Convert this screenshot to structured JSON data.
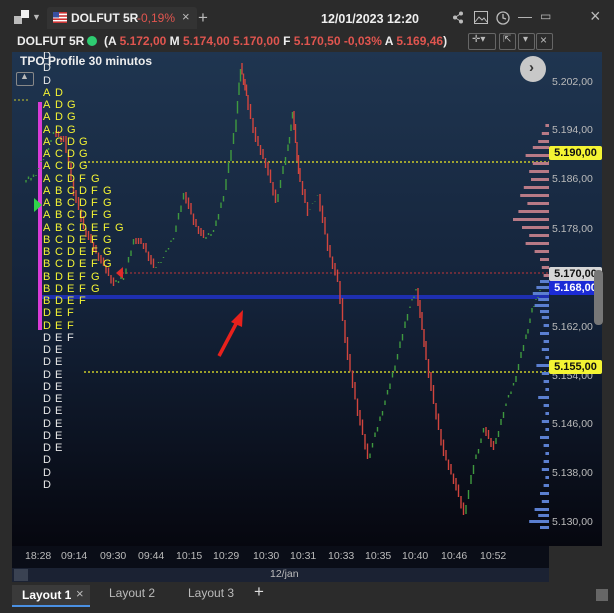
{
  "tab": {
    "symbol": "DOLFUT 5R",
    "change": "-0,19%",
    "datetime": "12/01/2023 12:20",
    "add_label": "+"
  },
  "header": {
    "symbol": "DOLFUT 5R",
    "quote_open_paren": "(",
    "a_label": "A",
    "a_value": "5.172,00",
    "m_label": "M",
    "m_value": "5.174,00",
    "mi_value": "5.170,00",
    "f_label": "F",
    "f_value": "5.170,50",
    "pct": "-0,03%",
    "a2_label": "A",
    "a2_value": "5.169,46",
    "close_paren": ")",
    "study": "TPO Profile 30 minutos"
  },
  "price_axis": {
    "labels": [
      "5.202,00",
      "5.194,00",
      "5.186,00",
      "5.178,00",
      "5.162,00",
      "5.154,00",
      "5.146,00",
      "5.138,00",
      "5.130,00"
    ],
    "tag_high": "5.190,00",
    "tag_last": "5.170,00",
    "tag_blue": "5.168,00",
    "tag_low": "5.155,00"
  },
  "time_axis": {
    "ticks": [
      "18:28",
      "09:14",
      "09:30",
      "09:44",
      "10:15",
      "10:29",
      "10:30",
      "10:31",
      "10:33",
      "10:35",
      "10:40",
      "10:46",
      "10:52"
    ],
    "date": "12/jan"
  },
  "tpo": {
    "rows": [
      " D",
      " D",
      " D",
      "A D",
      "A D G",
      "A D G",
      "A D G",
      "A C D G",
      "A C D G",
      "A C D G",
      "A C D F G",
      "A B C D F G",
      "A B C D F G",
      "A B C D F G",
      "A B C D E F G",
      "B C D E F G",
      "B C D E F G",
      "B C D E F G",
      "B D E F G",
      "B D E F G",
      "B D E F",
      "D E F",
      "D E F",
      "D E F",
      "D E",
      "D E",
      "D E",
      "D E",
      "D E",
      "D E",
      "D E",
      "D E",
      "D E",
      "D",
      "D",
      "D"
    ]
  },
  "footer": {
    "tabs": [
      "Layout 1",
      "Layout 2",
      "Layout 3"
    ],
    "close_label": "×",
    "add_label": "+"
  },
  "colors": {
    "up": "#3f9a3f",
    "down": "#d2453e",
    "tpo_yellow": "#f4f433",
    "tpo_white": "#e8e8e8",
    "poc_line": "#1e2fb0",
    "value_line": "#c9c92a",
    "profile_upper": "#b87a86",
    "profile_lower": "#5b7fd0",
    "accent_magenta": "#d93bd6"
  }
}
